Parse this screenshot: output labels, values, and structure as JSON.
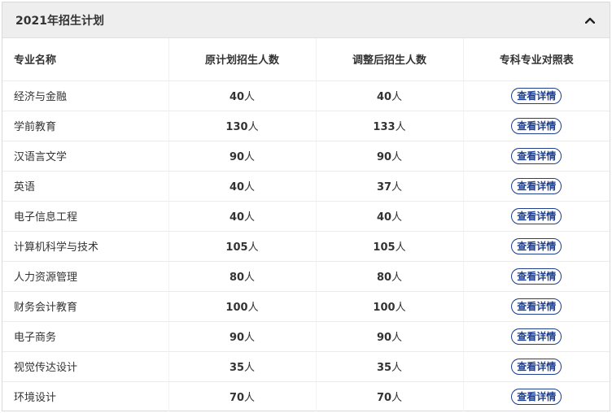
{
  "panel": {
    "title": "2021年招生计划",
    "collapse_icon": "chevron-up-icon"
  },
  "table": {
    "headers": [
      "专业名称",
      "原计划招生人数",
      "调整后招生人数",
      "专科专业对照表"
    ],
    "rows": [
      {
        "name": "经济与金融",
        "original": "40",
        "adjusted": "40",
        "unit": "人",
        "action": "查看详情"
      },
      {
        "name": "学前教育",
        "original": "130",
        "adjusted": "133",
        "unit": "人",
        "action": "查看详情"
      },
      {
        "name": "汉语言文学",
        "original": "90",
        "adjusted": "90",
        "unit": "人",
        "action": "查看详情"
      },
      {
        "name": "英语",
        "original": "40",
        "adjusted": "37",
        "unit": "人",
        "action": "查看详情"
      },
      {
        "name": "电子信息工程",
        "original": "40",
        "adjusted": "40",
        "unit": "人",
        "action": "查看详情"
      },
      {
        "name": "计算机科学与技术",
        "original": "105",
        "adjusted": "105",
        "unit": "人",
        "action": "查看详情"
      },
      {
        "name": "人力资源管理",
        "original": "80",
        "adjusted": "80",
        "unit": "人",
        "action": "查看详情"
      },
      {
        "name": "财务会计教育",
        "original": "100",
        "adjusted": "100",
        "unit": "人",
        "action": "查看详情"
      },
      {
        "name": "电子商务",
        "original": "90",
        "adjusted": "90",
        "unit": "人",
        "action": "查看详情"
      },
      {
        "name": "视觉传达设计",
        "original": "35",
        "adjusted": "35",
        "unit": "人",
        "action": "查看详情"
      },
      {
        "name": "环境设计",
        "original": "70",
        "adjusted": "70",
        "unit": "人",
        "action": "查看详情"
      }
    ]
  },
  "colors": {
    "header_bg": "#eeeeee",
    "button_accent": "#1f3f8f"
  }
}
